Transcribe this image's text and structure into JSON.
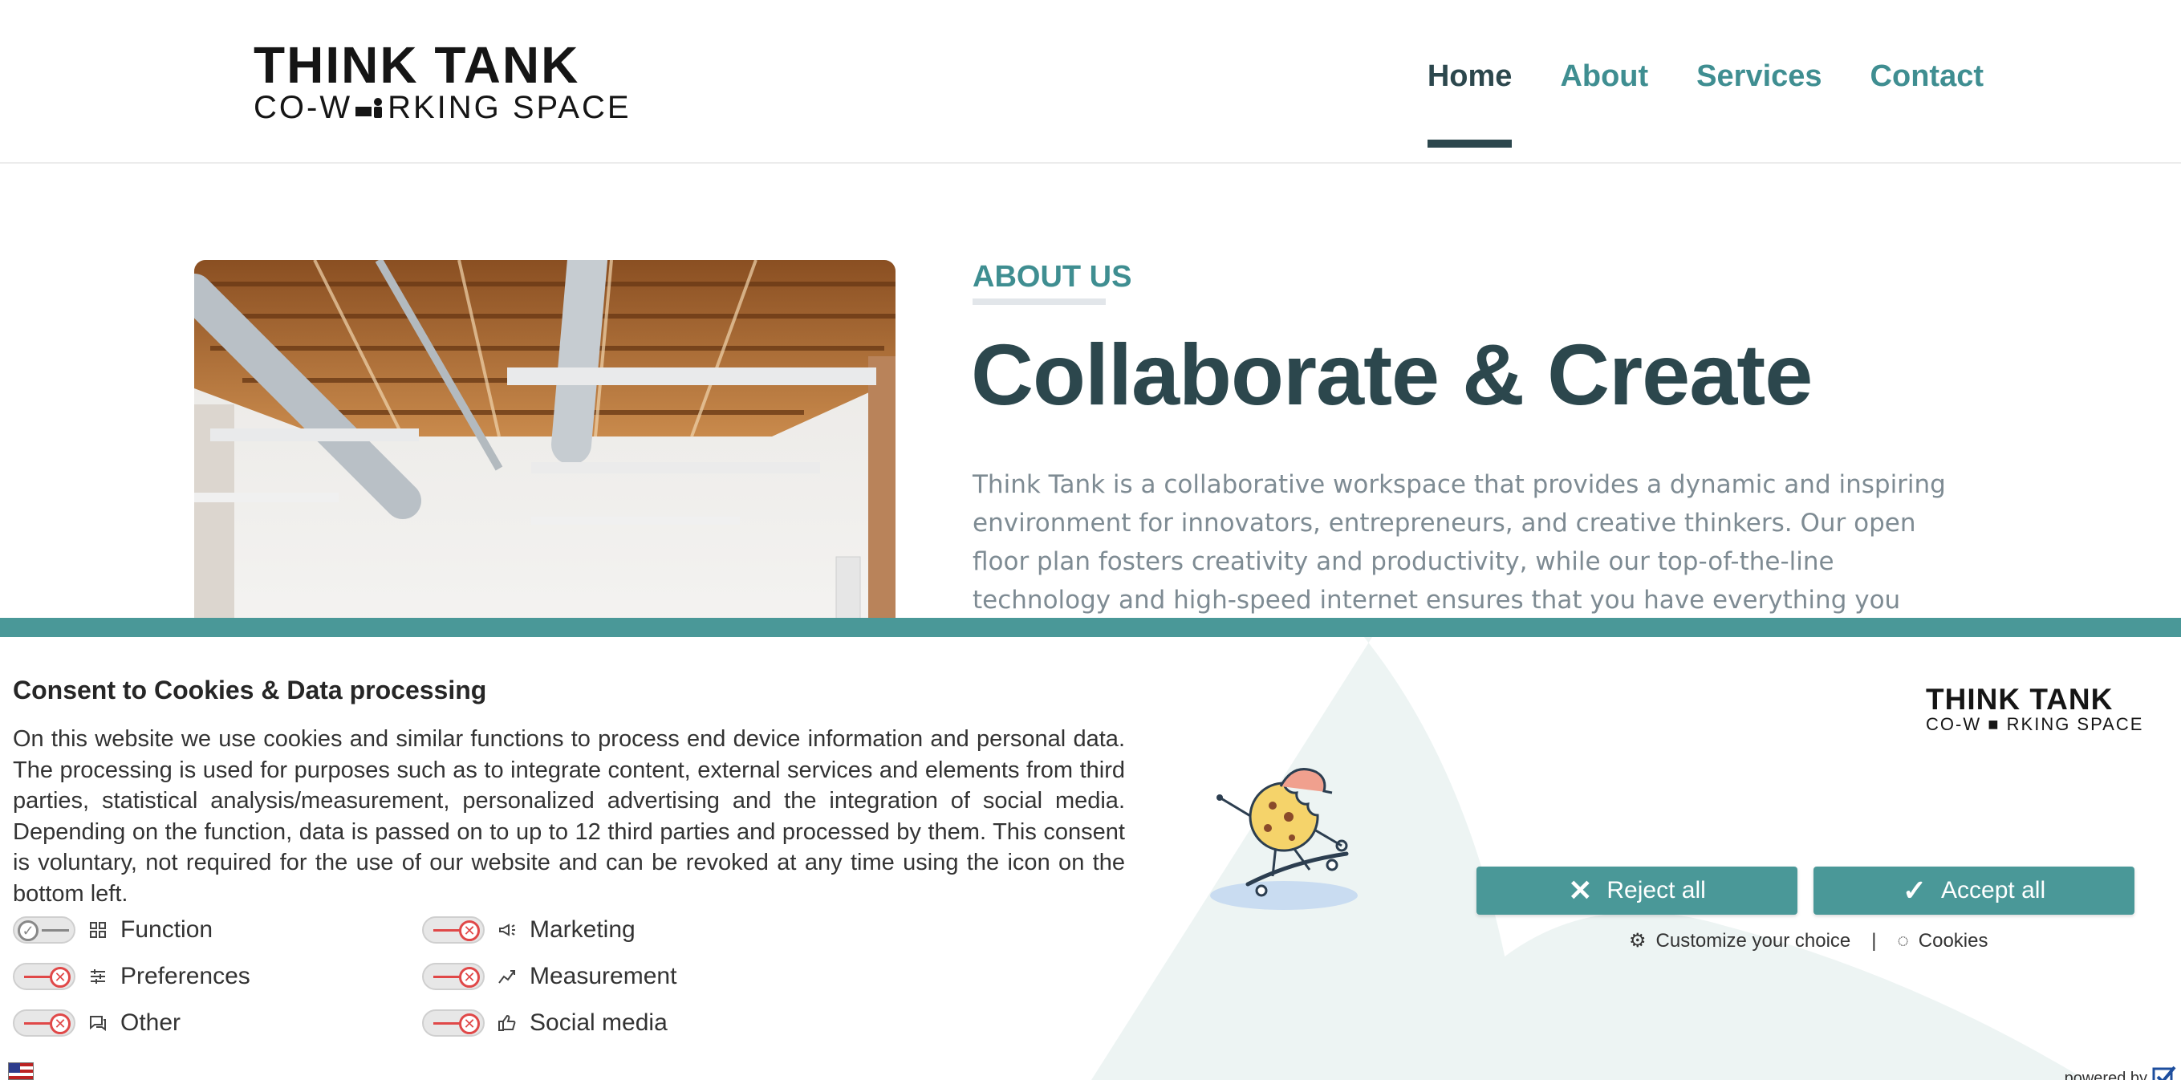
{
  "header": {
    "logo": {
      "line1": "THINK TANK",
      "line2_left": "CO-W",
      "line2_right": "RKING SPACE"
    },
    "nav": [
      {
        "label": "Home",
        "active": true
      },
      {
        "label": "About",
        "active": false
      },
      {
        "label": "Services",
        "active": false
      },
      {
        "label": "Contact",
        "active": false
      }
    ]
  },
  "hero": {
    "eyebrow": "ABOUT US",
    "title": "Collaborate & Create",
    "body": "Think Tank is a collaborative workspace that provides a dynamic and inspiring environment for innovators, entrepreneurs, and creative thinkers. Our open floor plan fosters creativity and productivity, while our top-of-the-line technology and high-speed internet ensures that you have everything you need to work efficiently. We're more than"
  },
  "consent": {
    "title": "Consent to Cookies & Data processing",
    "text": "On this website we use cookies and similar functions to process end device information and personal data. The processing is used for purposes such as to integrate content, external services and elements from third parties, statistical analysis/measurement, personalized advertising and the integration of social media. Depending on the function, data is passed on to up to 12 third parties and processed by them. This consent is voluntary, not required for the use of our website and can be revoked at any time using the icon on the bottom left.",
    "options": [
      {
        "label": "Function",
        "icon": "function-icon",
        "enabled": true
      },
      {
        "label": "Marketing",
        "icon": "megaphone-icon",
        "enabled": false
      },
      {
        "label": "Preferences",
        "icon": "sliders-icon",
        "enabled": false
      },
      {
        "label": "Measurement",
        "icon": "chart-icon",
        "enabled": false
      },
      {
        "label": "Other",
        "icon": "chat-icon",
        "enabled": false
      },
      {
        "label": "Social media",
        "icon": "thumbs-up-icon",
        "enabled": false
      }
    ],
    "logo": {
      "line1": "THINK TANK",
      "line2_left": "CO-W",
      "line2_right": "RKING SPACE"
    },
    "reject_label": "Reject all",
    "accept_label": "Accept all",
    "customize_label": "Customize your choice",
    "separator": "|",
    "cookies_label": "Cookies",
    "powered_by": "powered by",
    "accent_color": "#4a9898",
    "toggle_off_color": "#e04848"
  }
}
